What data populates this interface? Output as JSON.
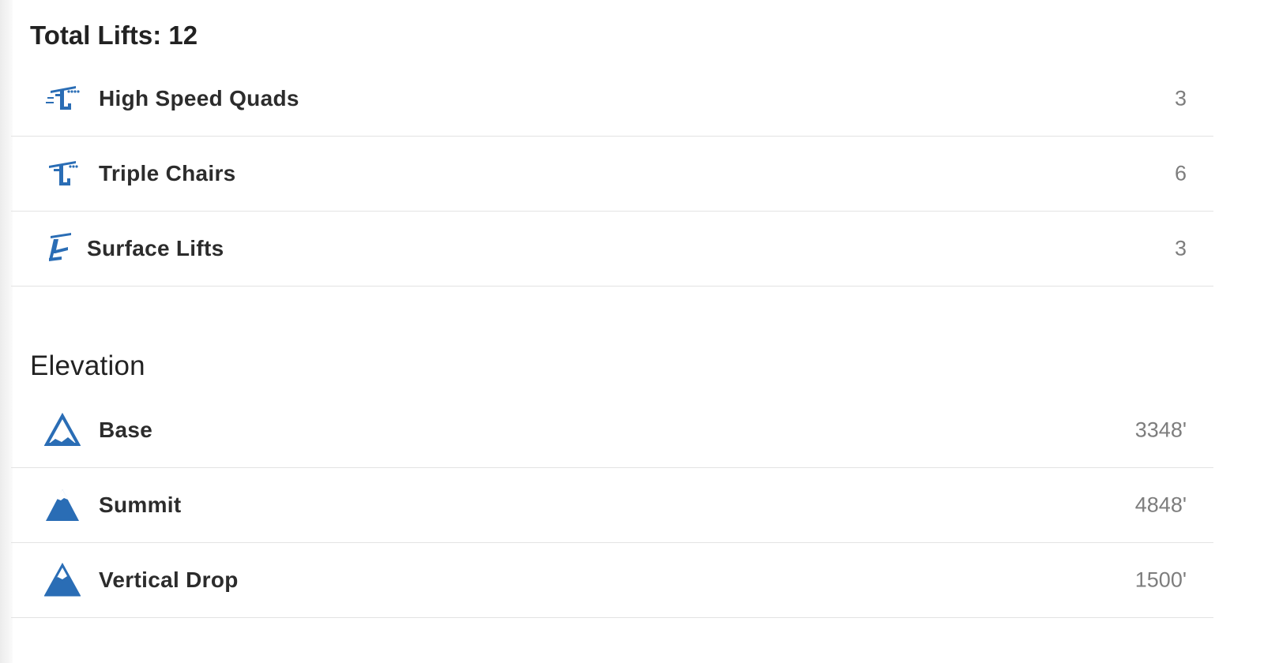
{
  "lifts": {
    "title": "Total Lifts: 12",
    "items": [
      {
        "label": "High Speed Quads",
        "value": "3",
        "icon": "high-speed-quad-lift-icon"
      },
      {
        "label": "Triple Chairs",
        "value": "6",
        "icon": "triple-chair-lift-icon"
      },
      {
        "label": "Surface Lifts",
        "value": "3",
        "icon": "surface-lift-icon"
      }
    ]
  },
  "elevation": {
    "title": "Elevation",
    "items": [
      {
        "label": "Base",
        "value": "3348'",
        "icon": "mountain-base-icon"
      },
      {
        "label": "Summit",
        "value": "4848'",
        "icon": "mountain-summit-icon"
      },
      {
        "label": "Vertical Drop",
        "value": "1500'",
        "icon": "mountain-vertical-drop-icon"
      }
    ]
  },
  "colors": {
    "icon_blue": "#2a6db5",
    "label_text": "#2c2c2c",
    "value_text": "#7d7d7d",
    "divider": "#e3e3e3"
  }
}
